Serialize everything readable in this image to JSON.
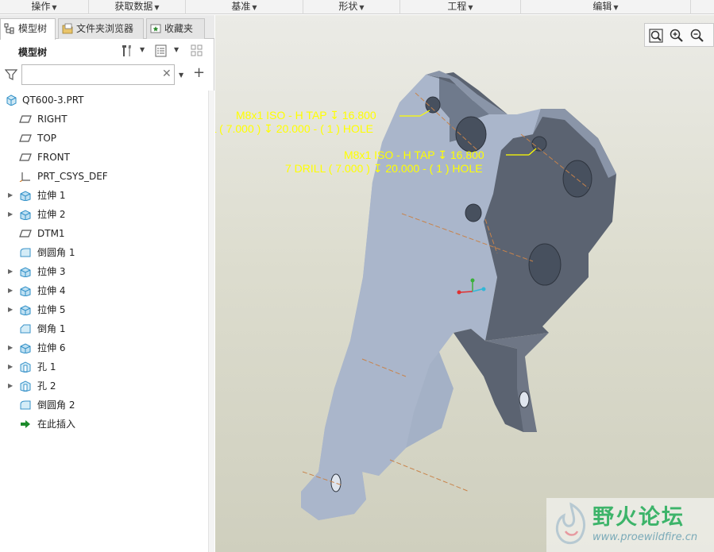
{
  "ribbon": {
    "groups": [
      {
        "label": "操作"
      },
      {
        "label": "获取数据"
      },
      {
        "label": "基准"
      },
      {
        "label": "形状"
      },
      {
        "label": "工程"
      },
      {
        "label": "编辑"
      }
    ]
  },
  "tabs": {
    "model_tree": "模型树",
    "folder_browser": "文件夹浏览器",
    "favorites": "收藏夹"
  },
  "tree_toolbar": {
    "title": "模型树"
  },
  "filter": {
    "value": "",
    "placeholder": ""
  },
  "tree": {
    "root": "QT600-3.PRT",
    "items": [
      {
        "label": "RIGHT",
        "icon": "datum-plane-icon",
        "expandable": false
      },
      {
        "label": "TOP",
        "icon": "datum-plane-icon",
        "expandable": false
      },
      {
        "label": "FRONT",
        "icon": "datum-plane-icon",
        "expandable": false
      },
      {
        "label": "PRT_CSYS_DEF",
        "icon": "csys-icon",
        "expandable": false
      },
      {
        "label": "拉伸 1",
        "icon": "extrude-icon",
        "expandable": true
      },
      {
        "label": "拉伸 2",
        "icon": "extrude-icon",
        "expandable": true
      },
      {
        "label": "DTM1",
        "icon": "datum-plane-icon",
        "expandable": false
      },
      {
        "label": "倒圆角 1",
        "icon": "round-icon",
        "expandable": false
      },
      {
        "label": "拉伸 3",
        "icon": "extrude-icon",
        "expandable": true
      },
      {
        "label": "拉伸 4",
        "icon": "extrude-icon",
        "expandable": true
      },
      {
        "label": "拉伸 5",
        "icon": "extrude-icon",
        "expandable": true
      },
      {
        "label": "倒角 1",
        "icon": "chamfer-icon",
        "expandable": false
      },
      {
        "label": "拉伸 6",
        "icon": "extrude-icon",
        "expandable": true
      },
      {
        "label": "孔 1",
        "icon": "hole-icon",
        "expandable": true
      },
      {
        "label": "孔 2",
        "icon": "hole-icon",
        "expandable": true
      },
      {
        "label": "倒圆角 2",
        "icon": "round-icon",
        "expandable": false
      },
      {
        "label": "在此插入",
        "icon": "insert-here-icon",
        "expandable": false
      }
    ]
  },
  "viewport": {
    "annotation_1_line1": "M8x1 ISO - H TAP ↧  16.800",
    "annotation_1_line2": "L ( 7.000 ) ↧  20.000  - ( 1 ) HOLE",
    "annotation_2_line1": "M8x1 ISO - H TAP ↧  16.800",
    "annotation_2_line2": "7 DRILL ( 7.000 ) ↧  20.000  - ( 1 ) HOLE",
    "annotation_color": "#ffff00",
    "part_color": "#a8b4c8",
    "background_color": "#dcdccd"
  },
  "watermark": {
    "title": "野火论坛",
    "url": "www.proewildfire.cn"
  }
}
